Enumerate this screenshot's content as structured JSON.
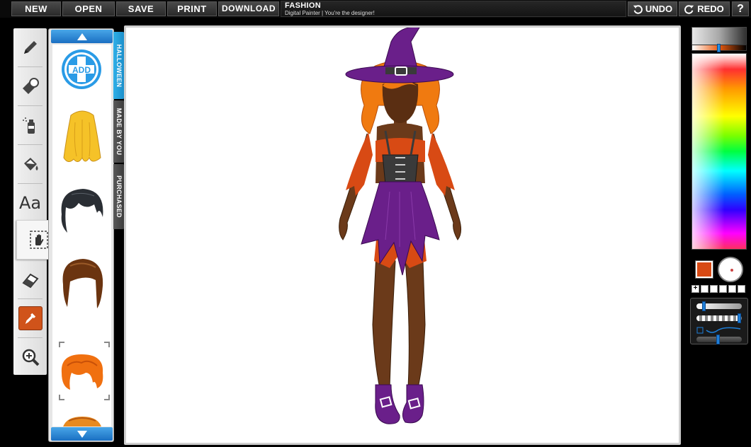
{
  "menu": {
    "new": "NEW",
    "open": "OPEN",
    "save": "SAVE",
    "print": "PRINT",
    "download": "DOWNLOAD"
  },
  "brand": {
    "title": "FASHION",
    "subtitle": "Digital Painter | You're the designer!"
  },
  "history": {
    "undo": "UNDO",
    "redo": "REDO",
    "help": "?"
  },
  "tools": [
    {
      "name": "pencil-tool",
      "icon": "pencil-icon"
    },
    {
      "name": "stamp-tool",
      "icon": "stamp-icon"
    },
    {
      "name": "spray-tool",
      "icon": "spray-can-icon"
    },
    {
      "name": "fill-tool",
      "icon": "paint-bucket-icon"
    },
    {
      "name": "text-tool",
      "icon": "text-icon",
      "label": "Aa"
    },
    {
      "name": "select-move-tool",
      "icon": "hand-select-icon",
      "active": true
    },
    {
      "name": "eraser-tool",
      "icon": "eraser-icon"
    },
    {
      "name": "eyedropper-tool",
      "icon": "eyedropper-icon"
    },
    {
      "name": "zoom-tool",
      "icon": "zoom-in-icon"
    }
  ],
  "panel": {
    "add_label": "ADD",
    "items": [
      "blonde-wavy-hair",
      "black-short-hair",
      "brown-bob-hair",
      "orange-curly-hair",
      "orange-bangs-hair"
    ],
    "selected_item": "orange-curly-hair"
  },
  "categories": [
    {
      "label": "HALLOWEEN",
      "active": true
    },
    {
      "label": "MADE BY YOU",
      "active": false
    },
    {
      "label": "PURCHASED",
      "active": false
    }
  ],
  "colors": {
    "current": "#d84a14",
    "hat": "#6a1f8a",
    "skin": "#6b3a1a",
    "hair": "#f07a10",
    "corset": "#3a3a3a",
    "accent_blue": "#1a8cc8"
  }
}
